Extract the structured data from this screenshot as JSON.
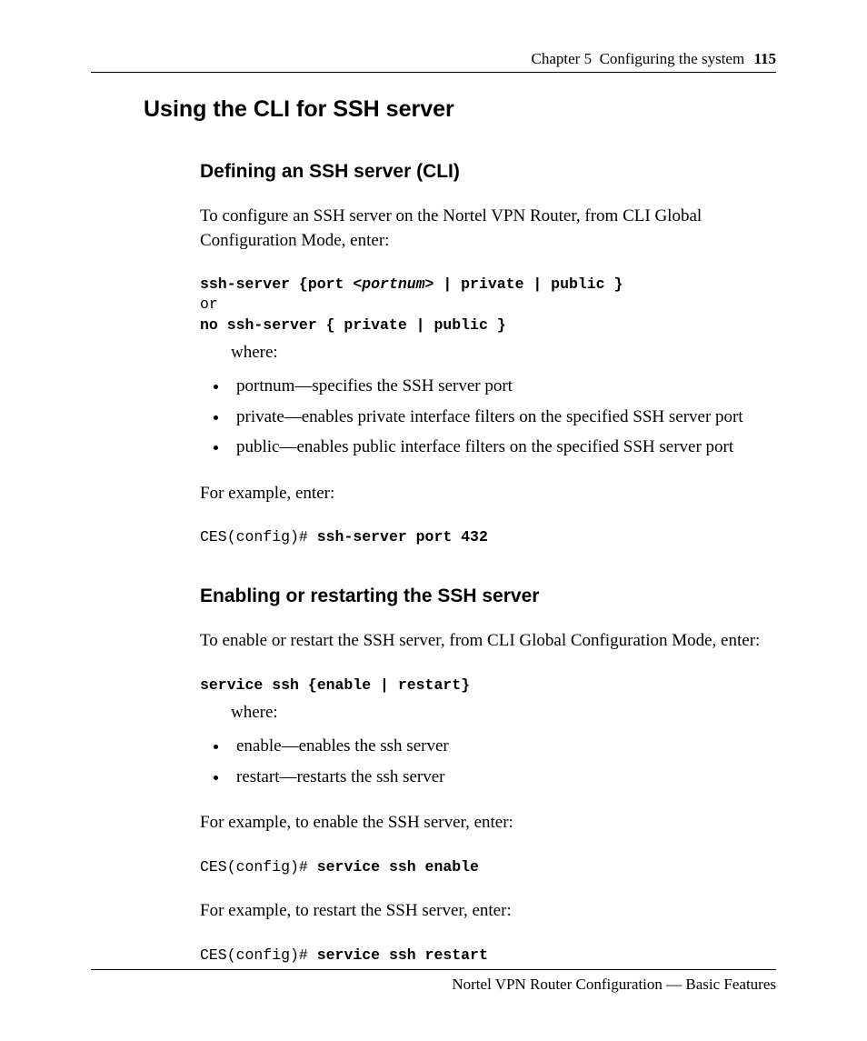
{
  "header": {
    "chapter_label": "Chapter 5",
    "chapter_title": "Configuring the system",
    "page_number": "115"
  },
  "h1": "Using the CLI for SSH server",
  "section1": {
    "heading": "Defining an SSH server (CLI)",
    "intro": "To configure an SSH server on the Nortel VPN Router, from CLI Global Configuration Mode, enter:",
    "code1_prefix": "ssh-server {port <",
    "code1_var": "portnum",
    "code1_suffix": "> | private | public }",
    "code_or": "or",
    "code2": "no ssh-server { private | public }",
    "where": "where:",
    "bullets": [
      "portnum—specifies the SSH server port",
      "private—enables private interface filters on the specified SSH server port",
      "public—enables public interface filters on the specified SSH server port"
    ],
    "example_intro": "For example, enter:",
    "example_prompt": "CES(config)# ",
    "example_cmd": "ssh-server port 432"
  },
  "section2": {
    "heading": "Enabling or restarting the SSH server",
    "intro": "To enable or restart the SSH server, from CLI Global Configuration Mode, enter:",
    "code1": "service ssh {enable | restart}",
    "where": "where:",
    "bullets": [
      "enable—enables the ssh server",
      "restart—restarts the ssh server"
    ],
    "example1_intro": "For example, to enable the SSH server, enter:",
    "example1_prompt": "CES(config)# ",
    "example1_cmd": "service ssh enable",
    "example2_intro": "For example, to restart the SSH server, enter:",
    "example2_prompt": "CES(config)# ",
    "example2_cmd": "service ssh restart"
  },
  "footer": "Nortel VPN Router Configuration — Basic Features"
}
